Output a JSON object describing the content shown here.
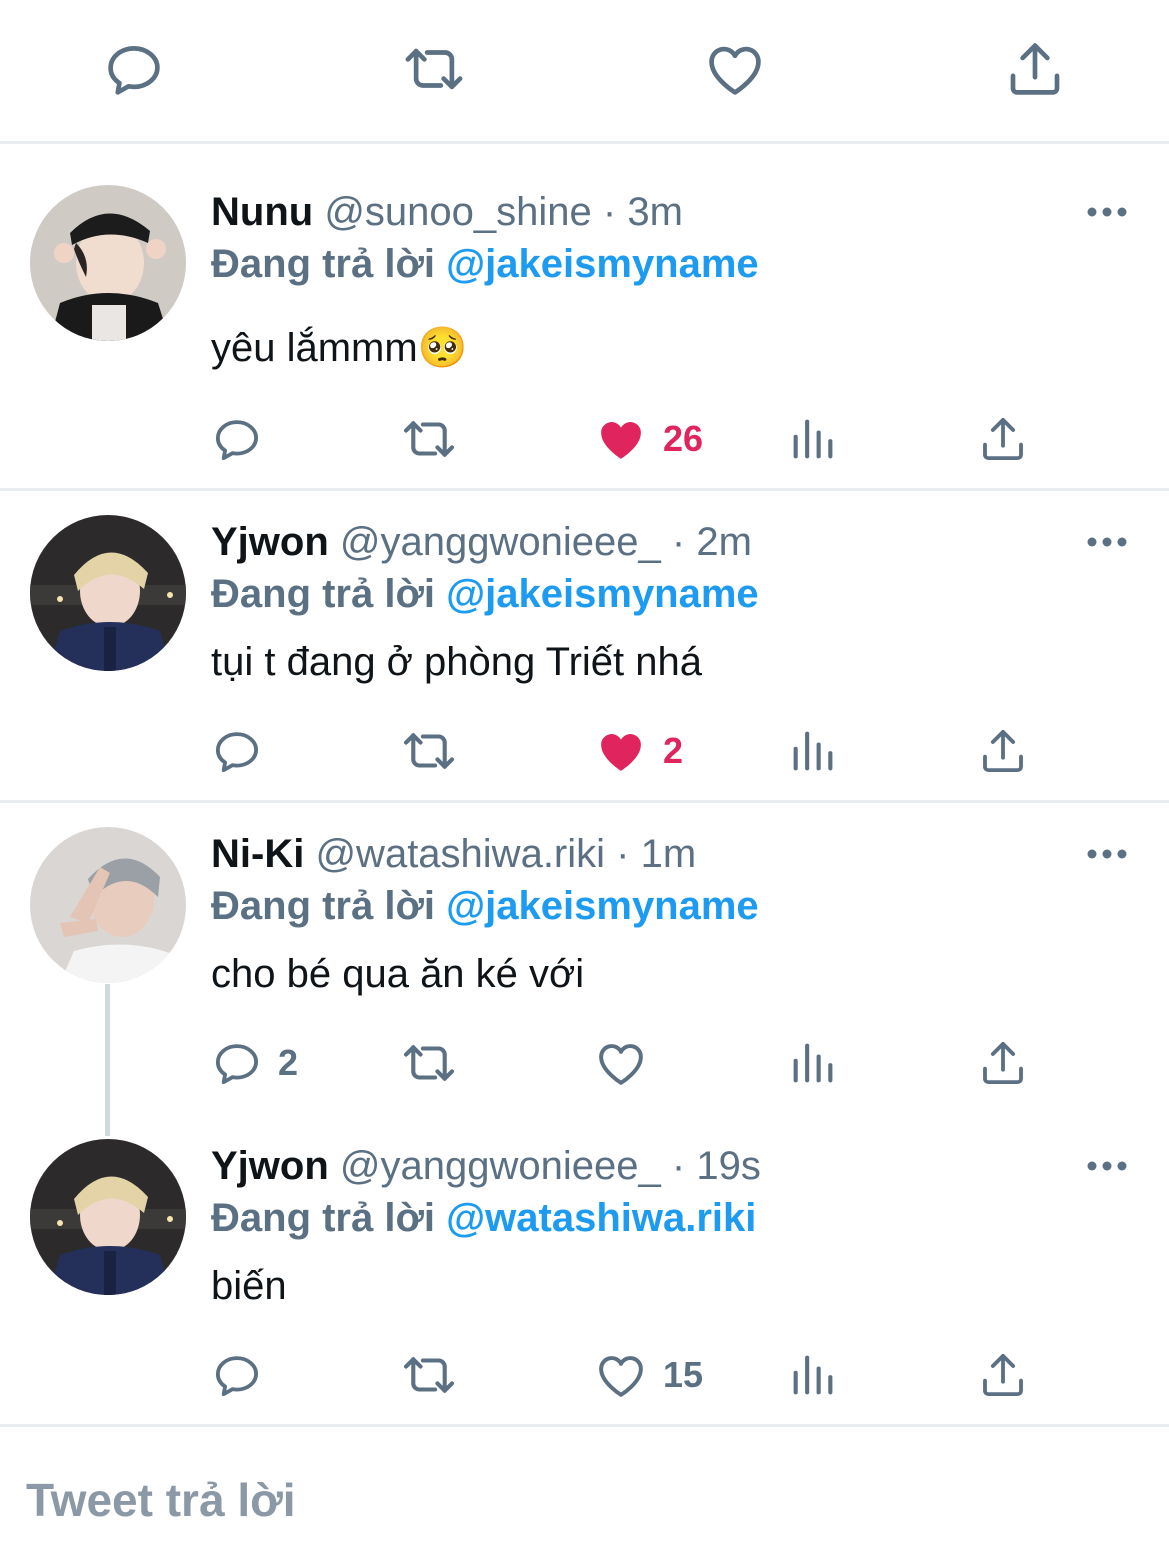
{
  "top_actions": [
    "reply-icon",
    "retweet-icon",
    "like-icon",
    "share-icon"
  ],
  "colors": {
    "text": "#0f1419",
    "secondary": "#5b7083",
    "link": "#1d9bf0",
    "like": "#e0245e",
    "divider": "#e6ecf0"
  },
  "tweets": [
    {
      "name": "Nunu",
      "handle": "@sunoo_shine",
      "dot": "·",
      "time": "3m",
      "reply_label": "Đang trả lời",
      "reply_to": "@jakeismyname",
      "text": "yêu lắmmm🥺",
      "reply_count": "",
      "like_count": "26",
      "liked": true
    },
    {
      "name": "Yjwon",
      "handle": "@yanggwonieee_",
      "dot": "·",
      "time": "2m",
      "reply_label": "Đang trả lời",
      "reply_to": "@jakeismyname",
      "text": "tụi t đang ở phòng Triết nhá",
      "reply_count": "",
      "like_count": "2",
      "liked": true
    },
    {
      "name": "Ni-Ki",
      "handle": "@watashiwa.riki",
      "dot": "·",
      "time": "1m",
      "reply_label": "Đang trả lời",
      "reply_to": "@jakeismyname",
      "text": "cho bé qua ăn ké với",
      "reply_count": "2",
      "like_count": "",
      "liked": false
    },
    {
      "name": "Yjwon",
      "handle": "@yanggwonieee_",
      "dot": "·",
      "time": "19s",
      "reply_label": "Đang trả lời",
      "reply_to": "@watashiwa.riki",
      "text": "biến",
      "reply_count": "",
      "like_count": "15",
      "liked": false
    }
  ],
  "compose": {
    "placeholder": "Tweet trả lời"
  }
}
